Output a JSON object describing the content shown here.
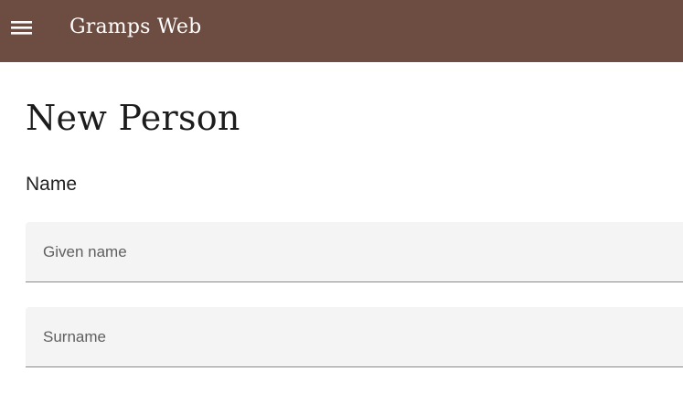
{
  "app_bar": {
    "title": "Gramps Web",
    "menu_icon": "menu-icon",
    "background_color": "#6d4c41"
  },
  "page": {
    "title": "New Person"
  },
  "name_section": {
    "label": "Name",
    "given_name": {
      "value": "",
      "placeholder": "Given name"
    },
    "surname": {
      "value": "",
      "placeholder": "Surname"
    }
  }
}
